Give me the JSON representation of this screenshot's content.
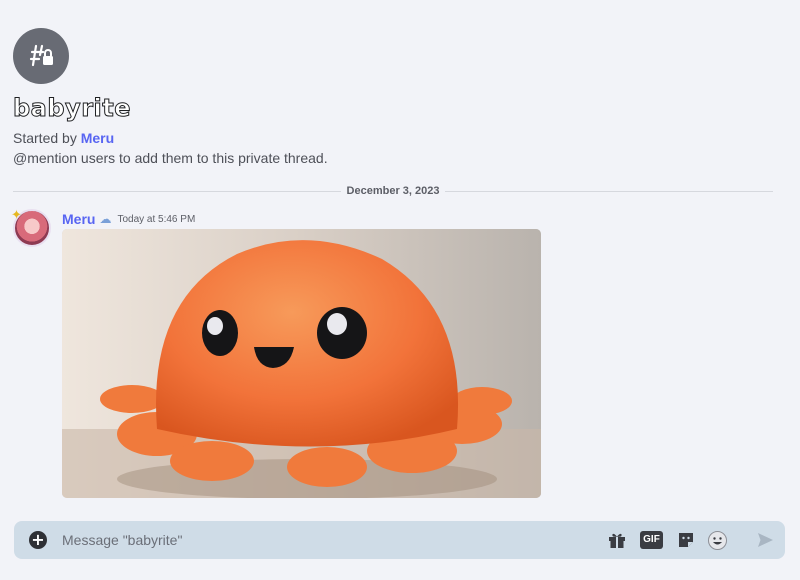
{
  "thread": {
    "name": "babyrite",
    "started_by_prefix": "Started by",
    "started_by_author": "Meru",
    "hint": "@mention users to add them to this private thread."
  },
  "divider": {
    "date": "December 3, 2023"
  },
  "message": {
    "author": "Meru",
    "badge_icon": "snow-cloud-icon",
    "timestamp": "Today at 5:46 PM",
    "attachment": "orange-crab-plush-photo"
  },
  "composer": {
    "placeholder": "Message \"babyrite\"",
    "gif_label": "GIF",
    "icons": [
      "add-circle-icon",
      "gift-icon",
      "gif-icon",
      "sticker-icon",
      "emoji-icon",
      "send-icon"
    ]
  },
  "colors": {
    "background": "#f2f3f8",
    "accent": "#5865f2",
    "thread_icon_bg": "#686b74",
    "composer_bg": "#cfdce7",
    "plush_orange": "#f2733a"
  }
}
